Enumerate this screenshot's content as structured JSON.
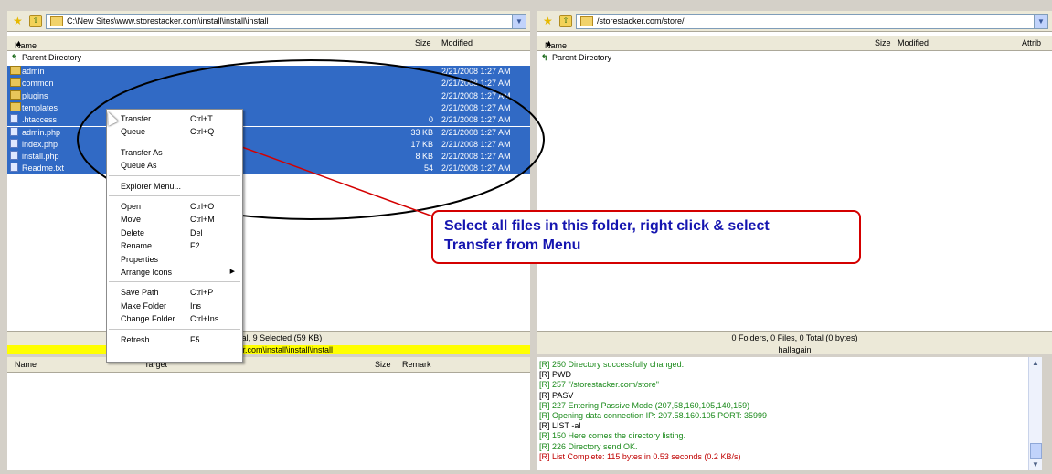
{
  "left": {
    "path": "C:\\New Sites\\www.storestacker.com\\install\\install\\install",
    "cols": {
      "name": "Name",
      "size": "Size",
      "modified": "Modified"
    },
    "parent": "Parent Directory",
    "rows": [
      {
        "name": "admin",
        "size": "",
        "modified": "2/21/2008 1:27 AM",
        "type": "folder"
      },
      {
        "name": "common",
        "size": "",
        "modified": "2/21/2008 1:27 AM",
        "type": "folder"
      },
      {
        "name": "plugins",
        "size": "",
        "modified": "2/21/2008 1:27 AM",
        "type": "folder"
      },
      {
        "name": "templates",
        "size": "",
        "modified": "2/21/2008 1:27 AM",
        "type": "folder"
      },
      {
        "name": ".htaccess",
        "size": "0",
        "modified": "2/21/2008 1:27 AM",
        "type": "file"
      },
      {
        "name": "admin.php",
        "size": "33 KB",
        "modified": "2/21/2008 1:27 AM",
        "type": "file"
      },
      {
        "name": "index.php",
        "size": "17 KB",
        "modified": "2/21/2008 1:27 AM",
        "type": "file"
      },
      {
        "name": "install.php",
        "size": "8 KB",
        "modified": "2/21/2008 1:27 AM",
        "type": "file"
      },
      {
        "name": "Readme.txt",
        "size": "54",
        "modified": "2/21/2008 1:27 AM",
        "type": "file"
      }
    ],
    "status": "s, 9 Total, 9 Selected (59 KB)",
    "status2": "torestacker.com\\install\\install\\install"
  },
  "right": {
    "path": "/storestacker.com/store/",
    "cols": {
      "name": "Name",
      "size": "Size",
      "modified": "Modified",
      "attrib": "Attrib"
    },
    "parent": "Parent Directory",
    "status": "0 Folders, 0 Files, 0 Total (0 bytes)",
    "status2": "hallagain"
  },
  "queue": {
    "cols": {
      "name": "Name",
      "target": "Target",
      "size": "Size",
      "remark": "Remark"
    }
  },
  "log": [
    {
      "text": "[R] 250 Directory successfully changed.",
      "color": "#1b8a1b"
    },
    {
      "text": "[R] PWD",
      "color": "#000000"
    },
    {
      "text": "[R] 257 \"/storestacker.com/store\"",
      "color": "#1b8a1b"
    },
    {
      "text": "[R] PASV",
      "color": "#000000"
    },
    {
      "text": "[R] 227 Entering Passive Mode (207,58,160,105,140,159)",
      "color": "#1b8a1b"
    },
    {
      "text": "[R] Opening data connection IP: 207.58.160.105 PORT: 35999",
      "color": "#1b8a1b"
    },
    {
      "text": "[R] LIST -al",
      "color": "#000000"
    },
    {
      "text": "[R] 150 Here comes the directory listing.",
      "color": "#1b8a1b"
    },
    {
      "text": "[R] 226 Directory send OK.",
      "color": "#1b8a1b"
    },
    {
      "text": "[R] List Complete: 115 bytes in 0.53 seconds (0.2 KB/s)",
      "color": "#c00000"
    }
  ],
  "menu": [
    {
      "label": "Transfer",
      "shortcut": "Ctrl+T"
    },
    {
      "label": "Queue",
      "shortcut": "Ctrl+Q"
    },
    {
      "sep": true
    },
    {
      "label": "Transfer As",
      "shortcut": ""
    },
    {
      "label": "Queue As",
      "shortcut": ""
    },
    {
      "sep": true
    },
    {
      "label": "Explorer Menu...",
      "shortcut": ""
    },
    {
      "sep": true
    },
    {
      "label": "Open",
      "shortcut": "Ctrl+O"
    },
    {
      "label": "Move",
      "shortcut": "Ctrl+M"
    },
    {
      "label": "Delete",
      "shortcut": "Del"
    },
    {
      "label": "Rename",
      "shortcut": "F2"
    },
    {
      "label": "Properties",
      "shortcut": ""
    },
    {
      "label": "Arrange Icons",
      "shortcut": "",
      "submenu": true
    },
    {
      "sep": true
    },
    {
      "label": "Save Path",
      "shortcut": "Ctrl+P"
    },
    {
      "label": "Make Folder",
      "shortcut": "Ins"
    },
    {
      "label": "Change Folder",
      "shortcut": "Ctrl+Ins"
    },
    {
      "sep": true
    },
    {
      "label": "Refresh",
      "shortcut": "F5"
    }
  ],
  "callout": {
    "line1": "Select all files in this folder, right click & select",
    "line2": "Transfer from Menu"
  },
  "colors": {
    "selection": "#316ac5",
    "annotation": "#d40000",
    "callout_text": "#1515b0",
    "status_highlight": "#ffff00"
  }
}
